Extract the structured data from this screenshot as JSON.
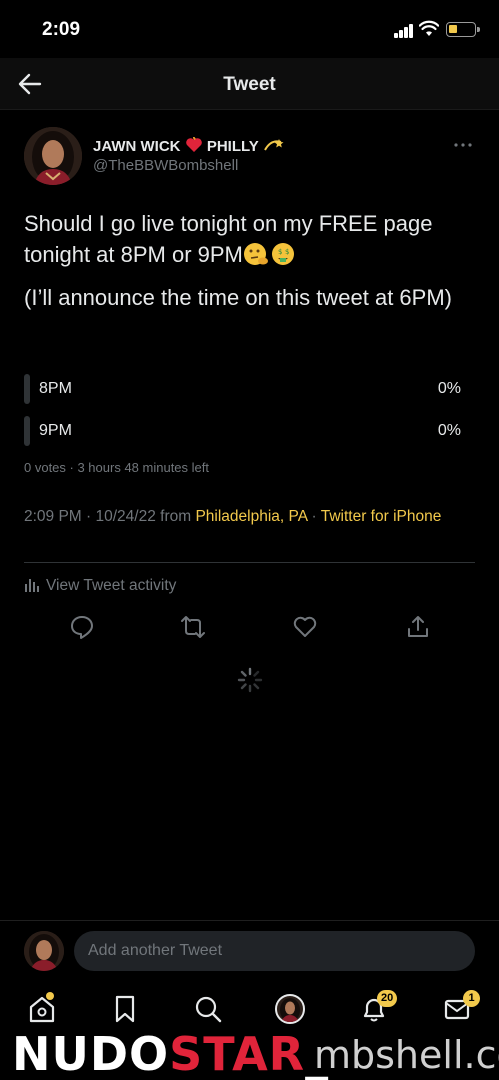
{
  "status_bar": {
    "time": "2:09",
    "battery_color": "#f2c94c"
  },
  "header": {
    "title": "Tweet",
    "back_icon": "arrow-left-icon"
  },
  "tweet": {
    "display_name": "JAWN WICK",
    "display_name_suffix": "PHILLY",
    "handle": "@TheBBWBombshell",
    "text_line1": "Should I go live tonight on my FREE page tonight at 8PM or 9PM",
    "text_line2": "(I’ll announce the time on this tweet at 6PM)",
    "poll": {
      "options": [
        {
          "label": "8PM",
          "percent": "0%"
        },
        {
          "label": "9PM",
          "percent": "0%"
        }
      ],
      "meta": "0 votes · 3 hours 48 minutes left"
    },
    "timestamp": "2:09 PM · 10/24/22 from",
    "location": "Philadelphia, PA",
    "separator": "·",
    "source": "Twitter for iPhone",
    "activity_label": "View Tweet activity"
  },
  "compose": {
    "placeholder": "Add another Tweet"
  },
  "tabs": {
    "notifications_count": "20",
    "messages_count": "1"
  },
  "accent_color": "#f2c94c",
  "watermark": {
    "brand_a": "NUDO",
    "brand_b": "STAR",
    "brand_tail": "_",
    "rest": "mbshell.co"
  }
}
